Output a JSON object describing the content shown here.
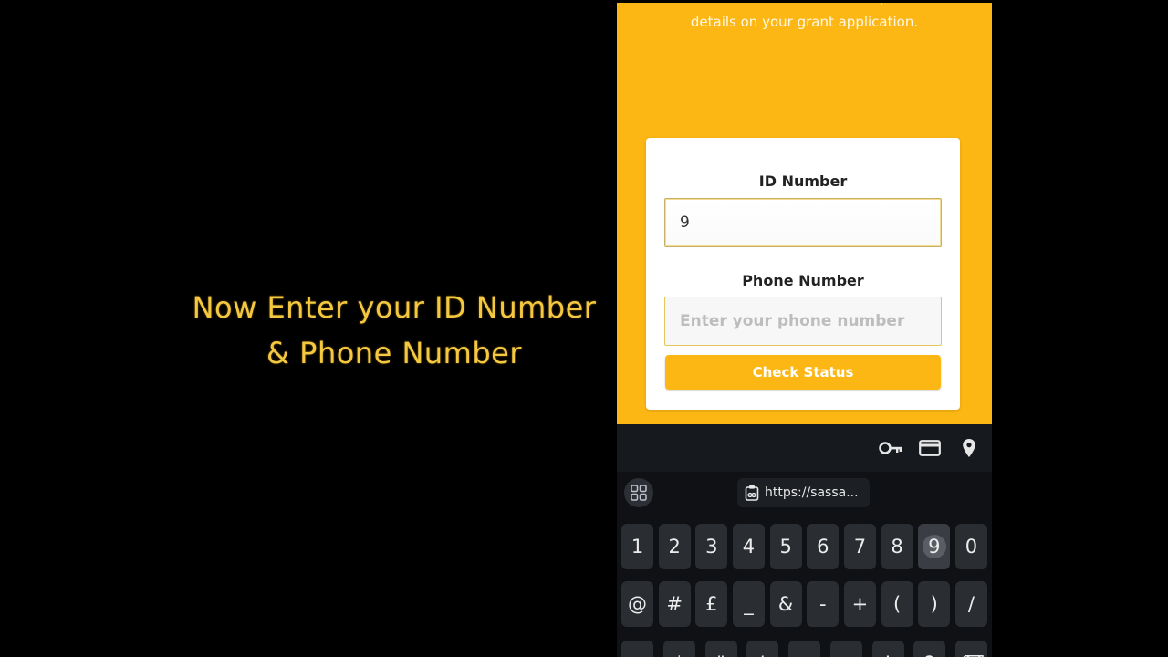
{
  "caption": {
    "line1": "Now Enter your ID Number",
    "line2": "& Phone Number"
  },
  "web": {
    "intro_line1": "and Phone Number to access up-to-date",
    "intro_line2": "details on your grant application.",
    "form": {
      "id_label": "ID Number",
      "id_value": "9",
      "phone_label": "Phone Number",
      "phone_placeholder": "Enter your phone number",
      "check_button": "Check Status"
    }
  },
  "autofill": {
    "icons": [
      "key-icon",
      "credit-card-icon",
      "location-pin-icon"
    ]
  },
  "keyboard": {
    "clipboard_chip": "https://sassa...",
    "row1": [
      "1",
      "2",
      "3",
      "4",
      "5",
      "6",
      "7",
      "8",
      "9",
      "0"
    ],
    "row2": [
      "@",
      "#",
      "£",
      "_",
      "&",
      "-",
      "+",
      "(",
      ")",
      "/"
    ],
    "row3": [
      "~",
      "*",
      "\"",
      "'",
      ":",
      ";",
      "!",
      "?",
      "⌫"
    ],
    "pressed_key": "9"
  },
  "colors": {
    "brand_yellow": "#fdb714",
    "caption_gold": "#f5c842",
    "keyboard_bg": "#0f1114",
    "key_bg": "#2a2d32"
  }
}
